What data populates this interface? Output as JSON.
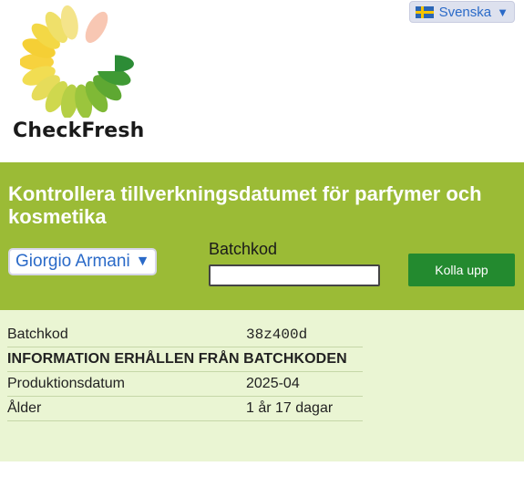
{
  "header": {
    "logo_text": "CheckFresh",
    "language": {
      "label": "Svenska",
      "flag": "sweden-flag-icon"
    }
  },
  "band": {
    "title": "Kontrollera tillverkningsdatumet för parfymer och kosmetika",
    "brand_selected": "Giorgio Armani",
    "batch_label": "Batchkod",
    "batch_input_value": "",
    "check_button": "Kolla upp",
    "colors": {
      "band": "#9bbb36",
      "button": "#238a2f",
      "link": "#2a6ac8"
    }
  },
  "result": {
    "batch_label": "Batchkod",
    "batch_value": "38z400d",
    "info_header": "INFORMATION ERHÅLLEN FRÅN BATCHKODEN",
    "rows": [
      {
        "label": "Produktionsdatum",
        "value": "2025-04"
      },
      {
        "label": "Ålder",
        "value": "1 år 17 dagar"
      }
    ],
    "background": "#eaf5d3"
  }
}
